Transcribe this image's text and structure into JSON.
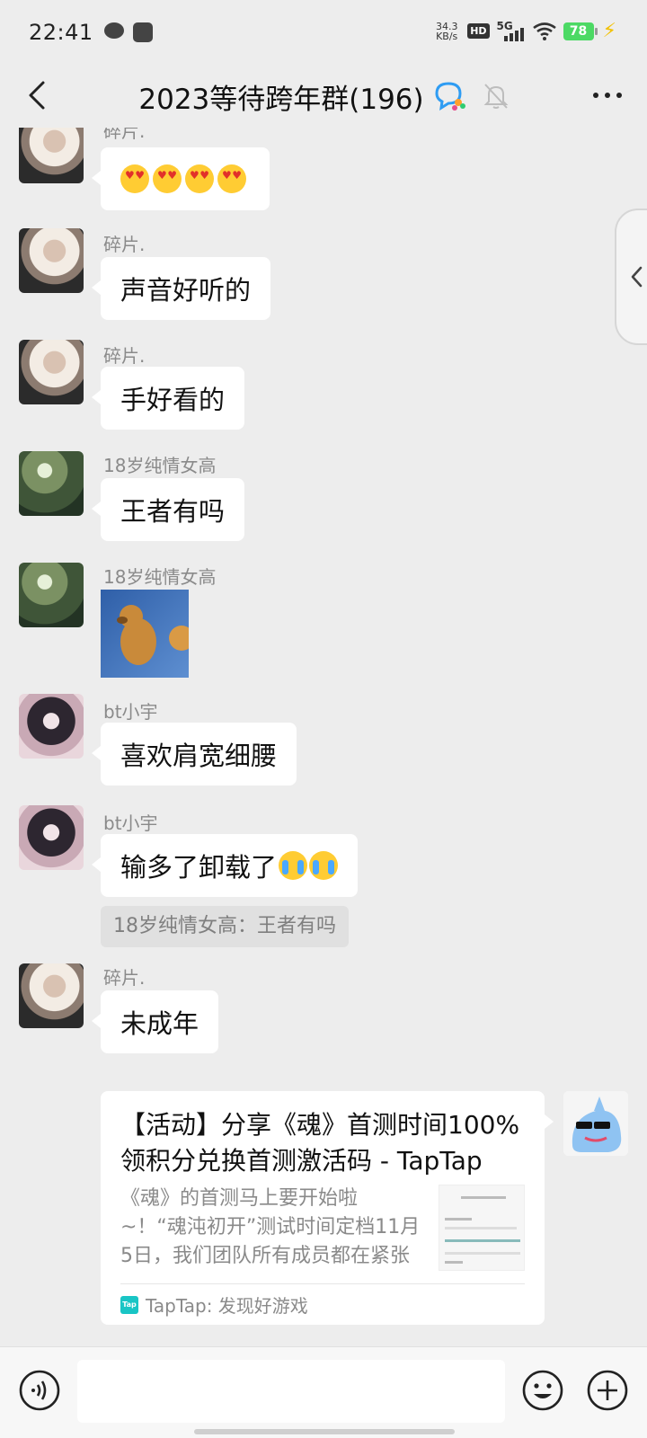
{
  "status_bar": {
    "time": "22:41",
    "net_speed_value": "34.3",
    "net_speed_unit": "KB/s",
    "hd_label": "HD",
    "network_label": "5G",
    "battery_level": "78"
  },
  "header": {
    "title": "2023等待跨年群(196)"
  },
  "messages": [
    {
      "sender": "碎片.",
      "text": ""
    },
    {
      "sender": "碎片.",
      "text": "声音好听的"
    },
    {
      "sender": "碎片.",
      "text": "手好看的"
    },
    {
      "sender": "18岁纯情女高",
      "text": "王者有吗"
    },
    {
      "sender": "18岁纯情女高",
      "text": ""
    },
    {
      "sender": "bt小宇",
      "text": "喜欢肩宽细腰"
    },
    {
      "sender": "bt小宇",
      "text": "输多了卸载了",
      "quote": "18岁纯情女高：王者有吗"
    },
    {
      "sender": "碎片.",
      "text": "未成年"
    }
  ],
  "link_card": {
    "title": "【活动】分享《魂》首测时间100%领积分兑换首测激活码 - TapTap",
    "description": "《魂》的首测马上要开始啦~！“魂沌初开”测试时间定档11月5日，我们团队所有成员都在紧张准备中",
    "source": "TapTap: 发现好游戏",
    "source_logo": "Tap"
  },
  "colors": {
    "background": "#ededed",
    "bubble": "#ffffff",
    "battery": "#4cd964",
    "taptap": "#19c5c5"
  }
}
